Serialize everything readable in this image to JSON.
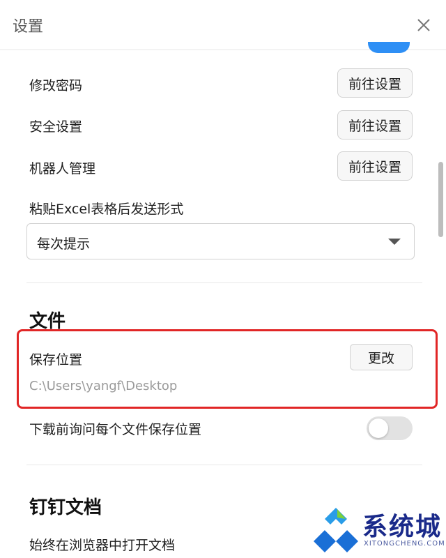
{
  "window": {
    "title": "设置"
  },
  "rows": [
    {
      "label": "修改密码",
      "button": "前往设置"
    },
    {
      "label": "安全设置",
      "button": "前往设置"
    },
    {
      "label": "机器人管理",
      "button": "前往设置"
    }
  ],
  "paste_excel": {
    "label": "粘贴Excel表格后发送形式",
    "value": "每次提示"
  },
  "file_section": {
    "title": "文件",
    "save_location": {
      "label": "保存位置",
      "button": "更改",
      "path": "C:\\Users\\yangf\\Desktop"
    },
    "ask_each_time": {
      "label": "下载前询问每个文件保存位置",
      "enabled": false
    }
  },
  "docs_section": {
    "title": "钉钉文档",
    "open_in_browser": {
      "label": "始终在浏览器中打开文档"
    }
  },
  "watermark": {
    "text": "系统城",
    "subtext": "XITONGCHENG.COM"
  },
  "colors": {
    "accent": "#2e8ff5",
    "highlight": "#e12626",
    "toggle_off": "#e2e2e2"
  }
}
